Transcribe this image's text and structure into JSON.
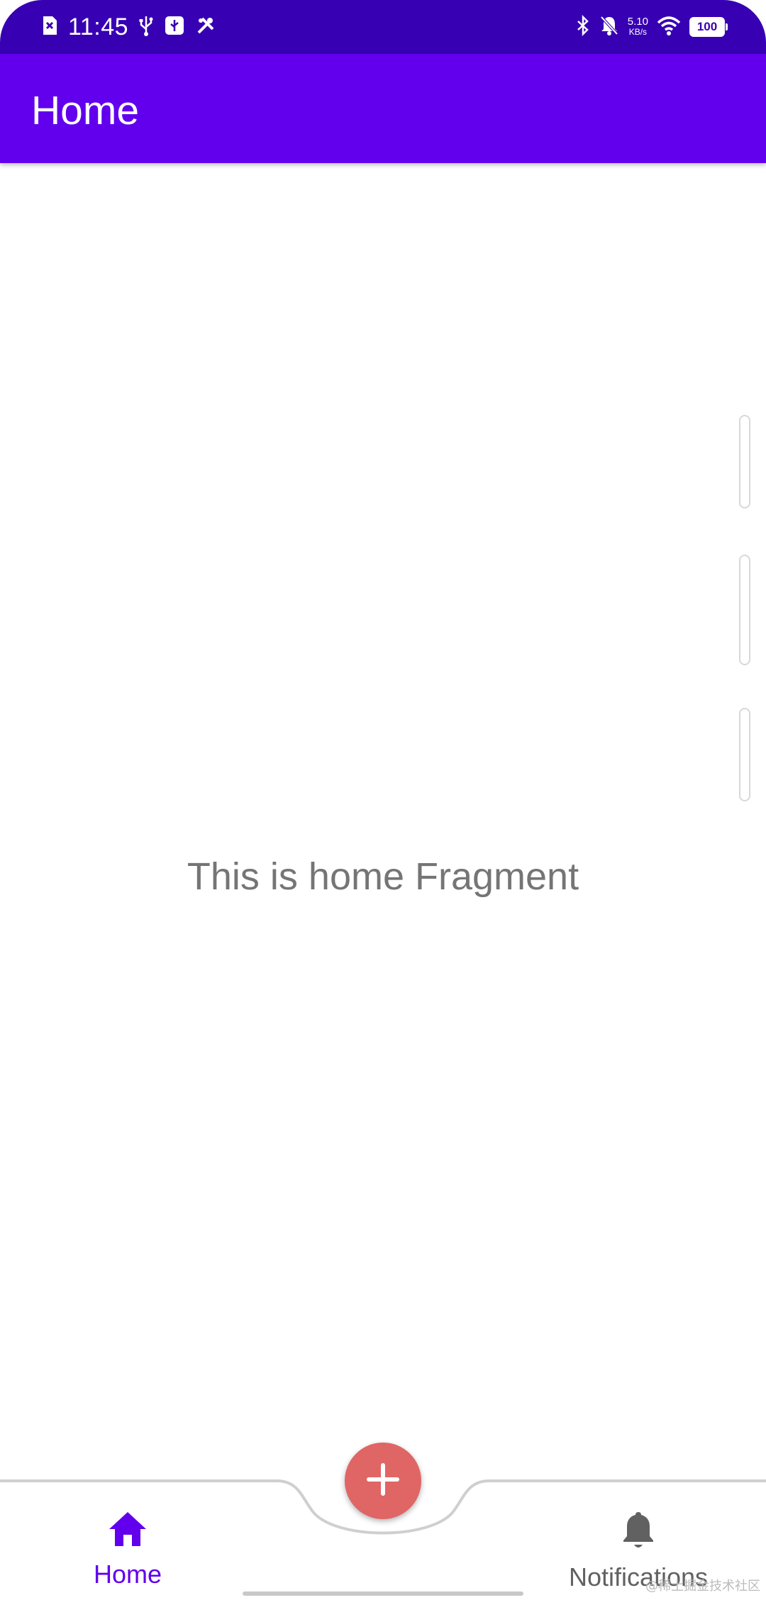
{
  "status_bar": {
    "time": "11:45",
    "left_icons": [
      "sim-error-icon",
      "usb-icon",
      "usb-debug-icon",
      "tools-icon"
    ],
    "right_icons": [
      "bluetooth-icon",
      "mute-icon",
      "wifi-icon",
      "battery-icon"
    ],
    "net_speed_value": "5.10",
    "net_speed_unit": "KB/s",
    "battery_level": "100",
    "background": "#3700b3"
  },
  "app_bar": {
    "title": "Home",
    "background": "#6200ee"
  },
  "main": {
    "message": "This is home Fragment"
  },
  "bottom_nav": {
    "items": [
      {
        "label": "Home",
        "icon": "home-icon",
        "selected": true,
        "color": "#6200ee"
      },
      {
        "label": "Notifications",
        "icon": "bell-icon",
        "selected": false,
        "color": "#616161"
      }
    ],
    "fab": {
      "icon": "plus-icon",
      "color": "#e06565"
    }
  },
  "watermark": "@稀土掘金技术社区"
}
